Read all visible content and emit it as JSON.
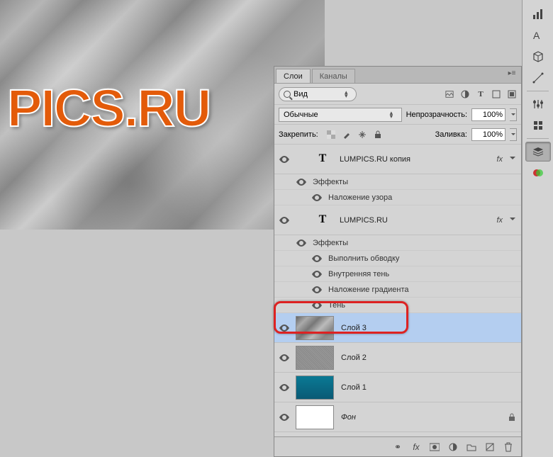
{
  "canvas": {
    "text": "PICS.RU"
  },
  "panel": {
    "tabs": {
      "layers": "Слои",
      "channels": "Каналы"
    },
    "search": {
      "label": "Вид",
      "placeholder": ""
    },
    "blend": {
      "mode": "Обычные",
      "opacity_label": "Непрозрачность:",
      "opacity_value": "100%"
    },
    "lock": {
      "label": "Закрепить:",
      "fill_label": "Заливка:",
      "fill_value": "100%"
    }
  },
  "layers": [
    {
      "type": "text",
      "name": "LUMPICS.RU копия",
      "fx": true,
      "effects_label": "Эффекты",
      "effects": [
        "Наложение узора"
      ]
    },
    {
      "type": "text",
      "name": "LUMPICS.RU",
      "fx": true,
      "effects_label": "Эффекты",
      "effects": [
        "Выполнить обводку",
        "Внутренняя тень",
        "Наложение градиента",
        "Тень"
      ]
    },
    {
      "type": "raster",
      "name": "Слой 3",
      "thumb": "clouds",
      "selected": true
    },
    {
      "type": "raster",
      "name": "Слой 2",
      "thumb": "noise"
    },
    {
      "type": "raster",
      "name": "Слой 1",
      "thumb": "teal"
    },
    {
      "type": "raster",
      "name": "Фон",
      "thumb": "white",
      "locked": true
    }
  ],
  "icons": {
    "fx": "fx"
  }
}
